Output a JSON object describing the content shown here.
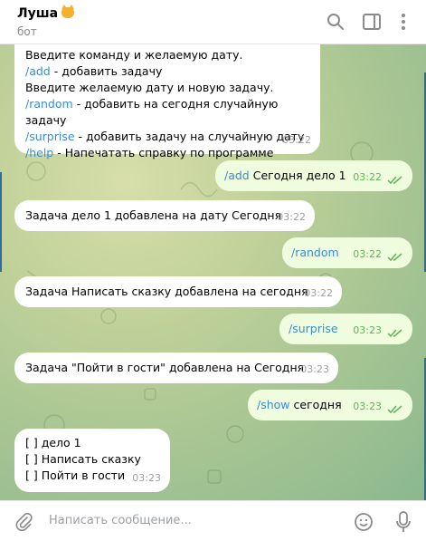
{
  "header": {
    "title": "Луша",
    "subtitle": "бот",
    "icons": [
      "search-icon",
      "sidebar-toggle-icon",
      "more-vert-icon"
    ]
  },
  "help": {
    "line1_partial": "Введите команду и желаемую дату.",
    "add_cmd": "/add",
    "add_desc": " - добавить задачу",
    "add_hint": "Введите желаемую дату и новую задачу.",
    "random_cmd": "/random",
    "random_desc": " - добавить на сегодня случайную задачу",
    "surprise_cmd": "/surprise",
    "surprise_desc": " - добавить задачу на случайную дату",
    "help_cmd": "/help",
    "help_desc": " - Напечатать справку по программе",
    "time": "03:22"
  },
  "messages": [
    {
      "dir": "out",
      "cmd": "/add",
      "text": " Сегодня дело 1",
      "time": "03:22"
    },
    {
      "dir": "in",
      "text": "Задача дело 1 добавлена на дату Сегодня",
      "time": "03:22"
    },
    {
      "dir": "out",
      "cmd": "/random",
      "text": "",
      "time": "03:22"
    },
    {
      "dir": "in",
      "text": "Задача Написать сказку добавлена на сегодня",
      "time": "03:22"
    },
    {
      "dir": "out",
      "cmd": "/surprise",
      "text": "",
      "time": "03:23"
    },
    {
      "dir": "in",
      "text": "Задача \"Пойти в гости\" добавлена на Сегодня",
      "time": "03:23"
    },
    {
      "dir": "out",
      "cmd": "/show",
      "text": " сегодня",
      "time": "03:23"
    }
  ],
  "list_msg": {
    "items": [
      "[ ] дело 1",
      "[ ] Написать сказку",
      "[ ] Пойти в гости"
    ],
    "time": "03:23"
  },
  "input": {
    "placeholder": "Написать сообщение..."
  },
  "colors": {
    "link": "#3a8bd0",
    "outgoing_bg": "#effdde",
    "tick": "#5fb357"
  }
}
